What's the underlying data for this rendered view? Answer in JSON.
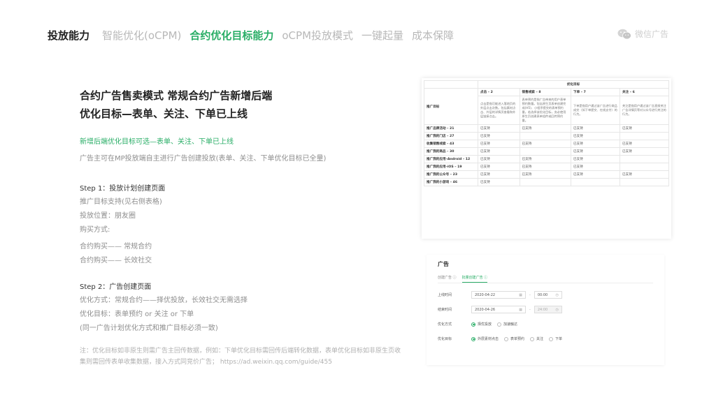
{
  "nav": {
    "items": [
      "投放能力",
      "智能优化(oCPM)",
      "合约优化目标能力",
      "oCPM投放模式",
      "一键起量",
      "成本保障"
    ],
    "active_index": 2
  },
  "brand": {
    "label": "微信广告",
    "icon": "wechat-icon"
  },
  "main": {
    "headline_1": "合约广告售卖模式 常规合约广告新增后端",
    "headline_2": "优化目标—表单、关注、下单已上线",
    "highlight": "新增后端优化目标可选—表单、关注、下单已上线",
    "subtitle": "广告主可在MP投放端自主进行广告创建投放(表单、关注、下单优化目标已全量)",
    "step1_title": "Step 1：投放计划创建页面",
    "step1_lines": [
      "推广目标支持(见右侧表格)",
      "投放位置：朋友圈",
      "购买方式:"
    ],
    "step1_buy": [
      "合约购买—— 常规合约",
      "合约购买—— 长效社交"
    ],
    "step2_title": "Step 2：广告创建页面",
    "step2_lines": [
      "优化方式：常规合约——择优投放，长效社交无需选择",
      "优化目标：表单预约 or 关注 or 下单",
      "(同一广告计划优化方式和推广目标必须一致)"
    ],
    "note": "注：优化目标如非原生则需广告主回传数据，例如：下单优化目标需回传后端转化数据，表单优化目标如非原生页收集则需回传表单收集数据，接入方式同竞价广告； https://ad.weixin.qq.com/guide/455"
  },
  "table": {
    "group_header": "优化目标",
    "row_header": "推广目标",
    "columns": [
      "点击 – 2",
      "销售线索 – 8",
      "下单 – 7",
      "关注 – 6"
    ],
    "descriptions": [
      "点击是指可能进入落地页的外层点击次数。包括素材点击、外层的详情页查看和外层链接点击。",
      "表单预约是指广告带来的用户表单预约数量。包括原生页表单创建完成(H5)、小程序提交的表单预约量。若选择该优化目标，务必使用原生页创建表单组件或回传预约量。",
      "下单是指用户通过该广告进行商品成交（如下单提交、在线支付）的行为。",
      "关注是指用户通过该广告直接关注广告详情页等对公众号进行关注的行为。"
    ],
    "supported_label": "已支持",
    "rows": [
      {
        "name": "推广品牌活动 – 21",
        "support": [
          true,
          true,
          true,
          true
        ]
      },
      {
        "name": "推广我的门店 – 27",
        "support": [
          true,
          false,
          true,
          false
        ]
      },
      {
        "name": "收集销售线索 – 43",
        "support": [
          true,
          true,
          true,
          true
        ]
      },
      {
        "name": "推广我的商品 – 30",
        "support": [
          true,
          false,
          true,
          true
        ]
      },
      {
        "name": "推广我的应用–Android – 12",
        "support": [
          true,
          true,
          true,
          false
        ]
      },
      {
        "name": "推广我的应用–iOS – 19",
        "support": [
          true,
          true,
          true,
          false
        ]
      },
      {
        "name": "推广我的公众号 – 23",
        "support": [
          true,
          true,
          true,
          true
        ]
      },
      {
        "name": "推广我的小游戏 – 46",
        "support": [
          true,
          false,
          false,
          false
        ]
      }
    ]
  },
  "form": {
    "title": "广告",
    "tabs": [
      "创建广告 ⓘ",
      "批量创建广告 ⓘ"
    ],
    "active_tab": 1,
    "start_label": "上线时间",
    "start_date": "2020-04-22",
    "start_time": "00:00",
    "end_label": "结束时间",
    "end_date": "2020-04-26",
    "end_time": "24:00",
    "opt_label": "优化方式",
    "opt_options": [
      "择优投放",
      "加速触达"
    ],
    "goal_label": "优化目标",
    "goal_options": [
      "外层素材点击",
      "表单预约",
      "关注",
      "下单"
    ]
  }
}
